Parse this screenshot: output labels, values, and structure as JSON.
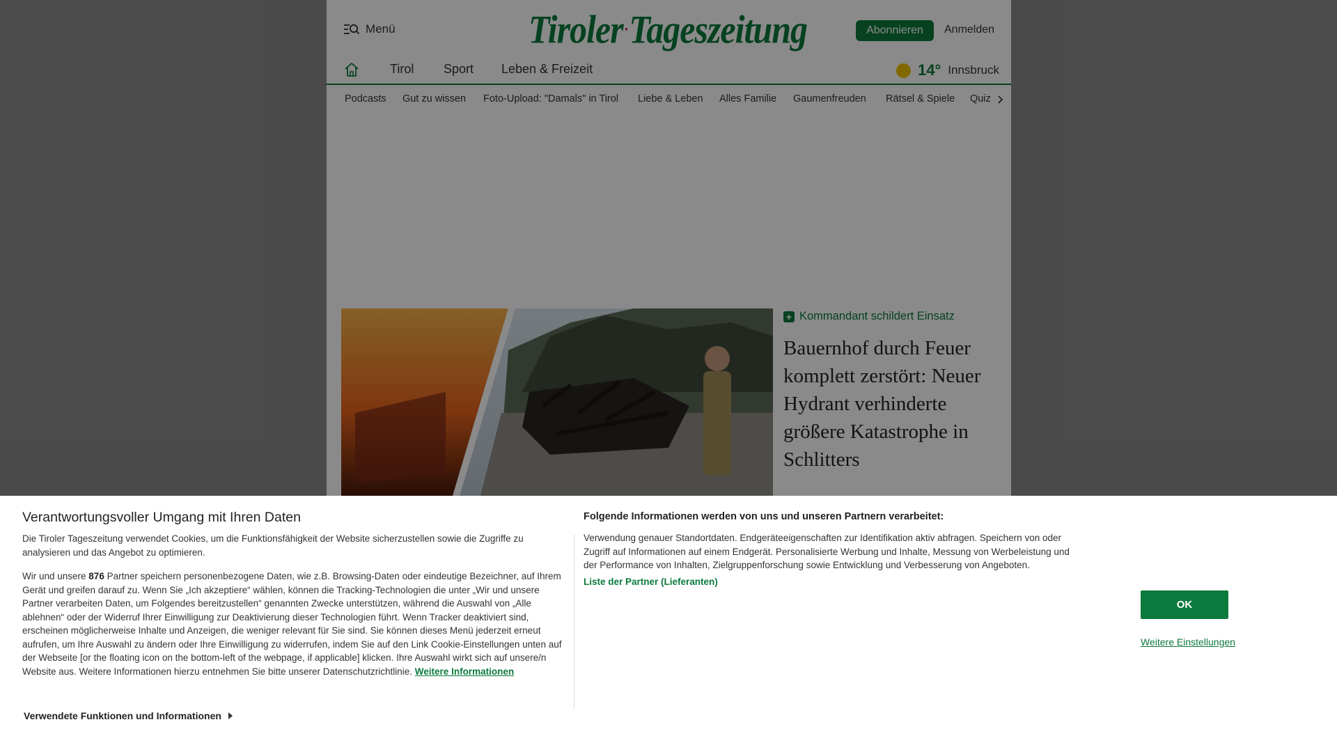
{
  "header": {
    "menu_label": "Menü",
    "logo_left": "Tiroler",
    "logo_right": "Tageszeitung",
    "subscribe_label": "Abonnieren",
    "login_label": "Anmelden"
  },
  "main_nav": {
    "items": [
      {
        "label": "Tirol"
      },
      {
        "label": "Sport"
      },
      {
        "label": "Leben & Freizeit"
      }
    ]
  },
  "weather": {
    "temperature": "14°",
    "city": "Innsbruck",
    "icon": "sun-icon"
  },
  "sub_nav": {
    "items": [
      {
        "label": "Podcasts"
      },
      {
        "label": "Gut zu wissen"
      },
      {
        "label": "Foto-Upload: \"Damals\" in Tirol"
      },
      {
        "label": "Liebe & Leben"
      },
      {
        "label": "Alles Familie"
      },
      {
        "label": "Gaumenfreuden"
      },
      {
        "label": "Rätsel & Spiele"
      },
      {
        "label": "Quiz"
      }
    ]
  },
  "article": {
    "kicker": "Kommandant schildert Einsatz",
    "headline": "Bauernhof durch Feuer komplett zerstört: Neuer Hydrant verhinderte größere Katastrophe in Schlitters"
  },
  "consent": {
    "title": "Verantwortungsvoller Umgang mit Ihren Daten",
    "intro": "Die Tiroler Tageszeitung verwendet Cookies, um die Funktionsfähigkeit der Website sicherzustellen sowie die Zugriffe zu analysieren und das Angebot zu optimieren.",
    "body_before_count": "Wir und unsere ",
    "partner_count": "876",
    "body_after_count": " Partner speichern personenbezogene Daten, wie z.B. Browsing-Daten oder eindeutige Bezeichner, auf Ihrem Gerät und greifen darauf zu. Wenn Sie „Ich akzeptiere“ wählen, können die Tracking-Technologien die unter „Wir und unsere Partner verarbeiten Daten, um Folgendes bereitzustellen“ genannten Zwecke unterstützen, während die Auswahl von „Alle ablehnen“ oder der Widerruf Ihrer Einwilligung zur Deaktivierung dieser Technologien führt. Wenn Tracker deaktiviert sind, erscheinen möglicherweise Inhalte und Anzeigen, die weniger relevant für Sie sind. Sie können dieses Menü jederzeit erneut aufrufen, um Ihre Auswahl zu ändern oder Ihre Einwilligung zu widerrufen, indem Sie auf den Link Cookie-Einstellungen unten auf der Webseite [or the floating icon on the bottom-left of the webpage, if applicable] klicken. Ihre Auswahl wirkt sich auf unsere/n Website aus. Weitere Informationen hierzu entnehmen Sie bitte unserer Datenschutzrichtlinie. ",
    "more_info_link": "Weitere Informationen",
    "functions_toggle": "Verwendete Funktionen und Informationen",
    "info_title": "Folgende Informationen werden von uns und unseren Partnern verarbeitet:",
    "info_text": "Verwendung genauer Standortdaten. Endgeräteeigenschaften zur Identifikation aktiv abfragen. Speichern von oder Zugriff auf Informationen auf einem Endgerät. Personalisierte Werbung und Inhalte, Messung von Werbeleistung und der Performance von Inhalten, Zielgruppenforschung sowie Entwicklung und Verbesserung von Angeboten.",
    "partners_link": "Liste der Partner (Lieferanten)",
    "ok_label": "OK",
    "settings_link": "Weitere Einstellungen"
  },
  "colors": {
    "brand_green": "#0c7a3c",
    "sun_yellow": "#f2c100"
  }
}
